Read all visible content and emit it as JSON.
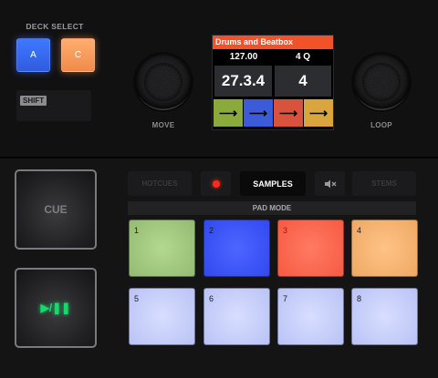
{
  "deck_select": {
    "label": "DECK SELECT",
    "button_a": "A",
    "button_c": "C",
    "shift": "SHIFT"
  },
  "knobs": {
    "move_label": "MOVE",
    "loop_label": "LOOP"
  },
  "screen": {
    "title": "Drums and Beatbox",
    "bpm": "127.00",
    "loop_size": "4 Q",
    "position": "27.3.4",
    "loop_big": "4",
    "strips": [
      {
        "arrow": "⟶",
        "color": "#8aab3c"
      },
      {
        "arrow": "⟶",
        "color": "#3c5bd9"
      },
      {
        "arrow": "⟶",
        "color": "#d9533c"
      },
      {
        "arrow": "⟶",
        "color": "#d9a53c"
      }
    ]
  },
  "transport": {
    "cue": "CUE",
    "play": "▶/❚❚"
  },
  "mode_buttons": {
    "hotcues": "HOTCUES",
    "samples": "SAMPLES",
    "stems": "STEMS",
    "record_color": "#ff2a1a"
  },
  "pad_mode": "PAD MODE",
  "pads": [
    {
      "num": "1",
      "color": "#a6cd84"
    },
    {
      "num": "2",
      "color": "#3f5bff"
    },
    {
      "num": "3",
      "color": "#ff6a52"
    },
    {
      "num": "4",
      "color": "#f6b673"
    },
    {
      "num": "5",
      "color": "#c9d2ff"
    },
    {
      "num": "6",
      "color": "#c9d2ff"
    },
    {
      "num": "7",
      "color": "#c9d2ff"
    },
    {
      "num": "8",
      "color": "#c9d2ff"
    }
  ]
}
